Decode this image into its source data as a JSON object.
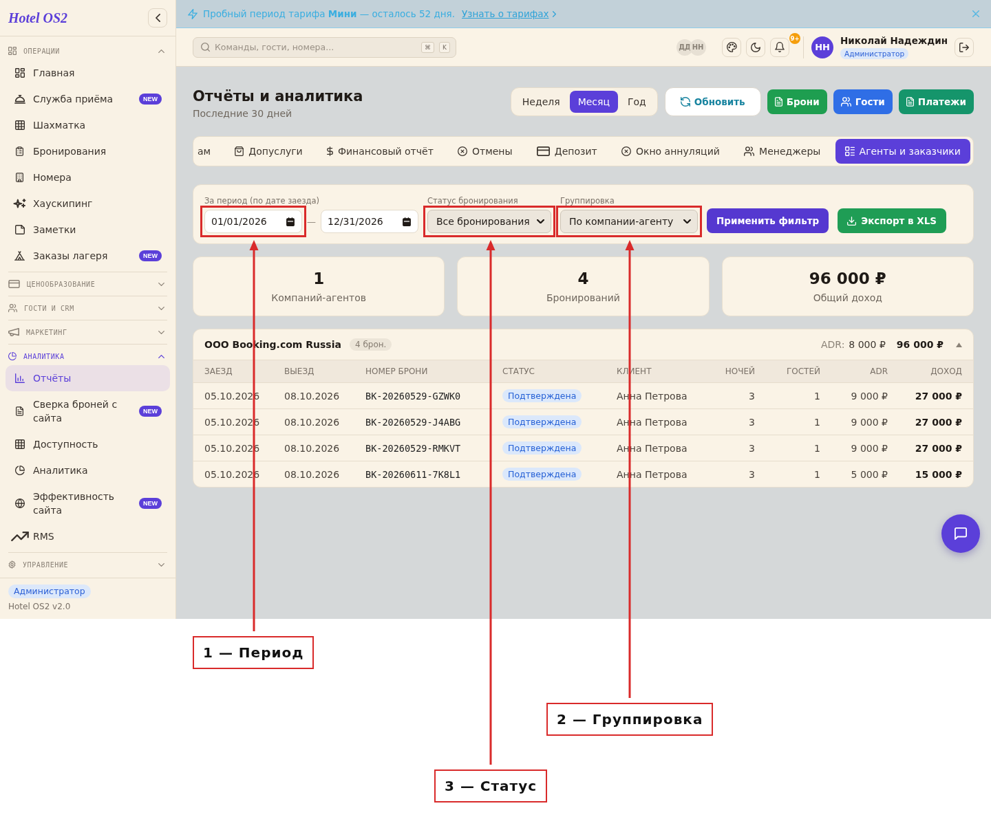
{
  "sidebar": {
    "logo": "Hotel OS2",
    "sections": [
      {
        "title": "ОПЕРАЦИИ",
        "expanded": true,
        "items": [
          {
            "label": "Главная",
            "selected": false
          },
          {
            "label": "Служба приёма",
            "badge": "NEW",
            "selected": false
          },
          {
            "label": "Шахматка",
            "selected": false
          },
          {
            "label": "Бронирования",
            "selected": false
          },
          {
            "label": "Номера",
            "selected": false
          },
          {
            "label": "Хаускипинг",
            "selected": false
          },
          {
            "label": "Заметки",
            "selected": false
          },
          {
            "label": "Заказы лагеря",
            "badge": "NEW",
            "selected": false
          }
        ]
      },
      {
        "title": "ЦЕНООБРАЗОВАНИЕ",
        "expanded": false
      },
      {
        "title": "ГОСТИ И CRM",
        "expanded": false
      },
      {
        "title": "МАРКЕТИНГ",
        "expanded": false
      },
      {
        "title": "АНАЛИТИКА",
        "expanded": true,
        "items": [
          {
            "label": "Отчёты",
            "selected": true
          },
          {
            "label": "Сверка броней с сайта",
            "badge": "NEW",
            "selected": false
          },
          {
            "label": "Доступность",
            "selected": false
          },
          {
            "label": "Аналитика",
            "selected": false
          },
          {
            "label": "Эффективность сайта",
            "badge": "NEW",
            "selected": false
          },
          {
            "label": "RMS",
            "selected": false
          }
        ]
      },
      {
        "title": "УПРАВЛЕНИЕ",
        "expanded": false
      }
    ],
    "footer": {
      "role": "Администратор",
      "version": "Hotel OS2 v2.0"
    }
  },
  "banner": {
    "text": "Пробный период тарифа **Мини** — осталось 52 дня.",
    "link": "Узнать о тарифах"
  },
  "topbar": {
    "search": {
      "placeholder": "Команды, гости, номера...",
      "shortcut": [
        "⌘",
        "K"
      ]
    },
    "presence": [
      "ДД",
      "НН"
    ],
    "notifications": "9+",
    "user": {
      "initials": "НН",
      "name": "Николай Надеждин",
      "role": "Администратор"
    }
  },
  "header": {
    "title": "Отчёты и аналитика",
    "subtitle": "Последние 30 дней",
    "periods": [
      {
        "label": "Неделя",
        "selected": false
      },
      {
        "label": "Месяц",
        "selected": true
      },
      {
        "label": "Год",
        "selected": false
      }
    ],
    "buttons": [
      {
        "label": "Обновить",
        "kind": "refresh"
      },
      {
        "label": "Брони",
        "kind": "bookings"
      },
      {
        "label": "Гости",
        "kind": "guests"
      },
      {
        "label": "Платежи",
        "kind": "payments"
      }
    ]
  },
  "tabs": [
    {
      "label": "ам",
      "selected": false
    },
    {
      "label": "Допуслуги",
      "selected": false
    },
    {
      "label": "Финансовый отчёт",
      "selected": false
    },
    {
      "label": "Отмены",
      "selected": false
    },
    {
      "label": "Депозит",
      "selected": false
    },
    {
      "label": "Окно аннуляций",
      "selected": false
    },
    {
      "label": "Менеджеры",
      "selected": false
    },
    {
      "label": "Агенты и заказчики",
      "selected": true
    }
  ],
  "filters": {
    "period_label": "За период (по дате заезда)",
    "dates": [
      {
        "value": "01/01/2026",
        "highlighted": true
      },
      {
        "value": "12/31/2026",
        "highlighted": false
      }
    ],
    "separator": "—",
    "selects": [
      {
        "label": "Статус бронирования",
        "value": "Все бронирования",
        "highlighted": true
      },
      {
        "label": "Группировка",
        "value": "По компании-агенту",
        "highlighted": true
      }
    ],
    "buttons": [
      {
        "label": "Применить фильтр",
        "kind": "apply"
      },
      {
        "label": "Экспорт в XLS",
        "kind": "export"
      }
    ]
  },
  "stats": [
    {
      "value": "1",
      "label": "Компаний-агентов"
    },
    {
      "value": "4",
      "label": "Бронирований"
    },
    {
      "value": "96 000 ₽",
      "label": "Общий доход"
    }
  ],
  "groups": [
    {
      "name": "ООО Booking.com Russia",
      "count": "4 брон.",
      "adr_label": "ADR:",
      "adr": "8 000 ₽",
      "total": "96 000 ₽",
      "expanded": true,
      "table": {
        "columns": [
          "ЗАЕЗД",
          "ВЫЕЗД",
          "НОМЕР БРОНИ",
          "СТАТУС",
          "КЛИЕНТ",
          "НОЧЕЙ",
          "ГОСТЕЙ",
          "ADR",
          "ДОХОД"
        ],
        "rows": [
          [
            "05.10.2026",
            "08.10.2026",
            "BK-20260529-GZWK0",
            "Подтверждена",
            "Анна Петрова",
            "3",
            "1",
            "9 000 ₽",
            "27 000 ₽"
          ],
          [
            "05.10.2026",
            "08.10.2026",
            "BK-20260529-J4ABG",
            "Подтверждена",
            "Анна Петрова",
            "3",
            "1",
            "9 000 ₽",
            "27 000 ₽"
          ],
          [
            "05.10.2026",
            "08.10.2026",
            "BK-20260529-RMKVT",
            "Подтверждена",
            "Анна Петрова",
            "3",
            "1",
            "9 000 ₽",
            "27 000 ₽"
          ],
          [
            "05.10.2026",
            "08.10.2026",
            "BK-20260611-7K8L1",
            "Подтверждена",
            "Анна Петрова",
            "3",
            "1",
            "5 000 ₽",
            "15 000 ₽"
          ]
        ]
      }
    }
  ],
  "annotations": [
    {
      "label": "1 — Период"
    },
    {
      "label": "2 — Группировка"
    },
    {
      "label": "3 — Статус"
    }
  ]
}
